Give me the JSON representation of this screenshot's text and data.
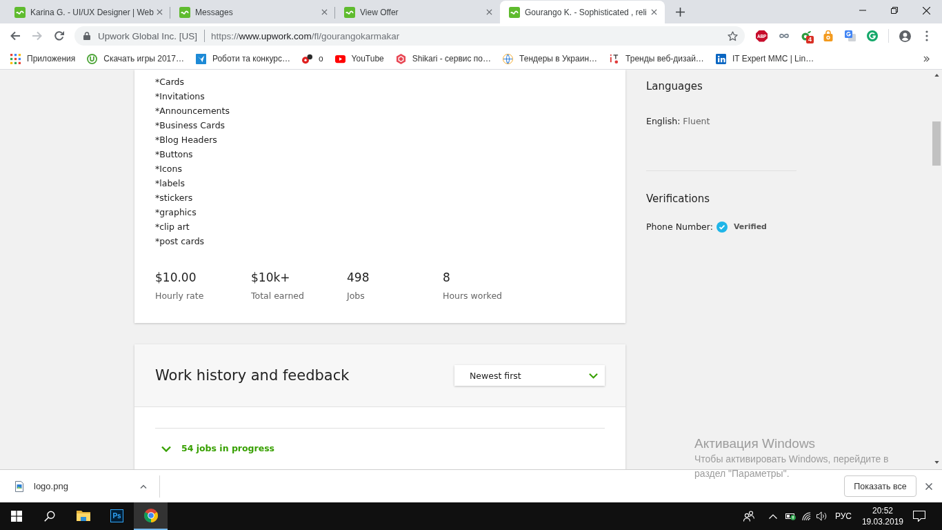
{
  "browser": {
    "tabs": [
      {
        "title": "Karina G. - UI/UX Designer | Web",
        "selected": false
      },
      {
        "title": "Messages",
        "selected": false
      },
      {
        "title": "View Offer",
        "selected": false
      },
      {
        "title": "Gourango K. - Sophisticated , reli",
        "selected": true
      }
    ],
    "navigation": {
      "back_disabled": false,
      "forward_disabled": true
    },
    "address_bar": {
      "site_identity": "Upwork Global Inc. [US]",
      "url_scheme": "https://",
      "url_host": "www.upwork.com",
      "url_path": "/fl/gourangokarmakar",
      "bookmarked": false
    },
    "extensions": {
      "adblock_label": "ABP",
      "badge_count": "4"
    },
    "bookmarks": [
      {
        "kind": "apps",
        "label": "Приложения"
      },
      {
        "kind": "torrent",
        "label": "Скачать игры 2017…"
      },
      {
        "kind": "bird",
        "label": "Роботи та конкурс…"
      },
      {
        "kind": "alert",
        "label": "о"
      },
      {
        "kind": "video",
        "label": "YouTube"
      },
      {
        "kind": "hexagon",
        "label": "Shikari - сервис по…"
      },
      {
        "kind": "globe",
        "label": "Тендеры в Украин…"
      },
      {
        "kind": "marker",
        "label": "Тренды веб-дизай…"
      },
      {
        "kind": "in_logo",
        "label": "IT Expert MMC | Lin…"
      }
    ]
  },
  "profile": {
    "services": [
      "*Cards",
      "*Invitations",
      "*Announcements",
      "*Business Cards",
      "*Blog Headers",
      "*Buttons",
      "*Icons",
      "*labels",
      "*stickers",
      "*graphics",
      "*clip art",
      "*post cards"
    ],
    "stats": [
      {
        "value": "$10.00",
        "label": "Hourly rate"
      },
      {
        "value": "$10k+",
        "label": "Total earned"
      },
      {
        "value": "498",
        "label": "Jobs"
      },
      {
        "value": "8",
        "label": "Hours worked"
      }
    ]
  },
  "work_history": {
    "title": "Work history and feedback",
    "sort": {
      "value": "Newest first"
    },
    "in_progress": {
      "label": "54 jobs in progress"
    }
  },
  "sidebar": {
    "languages": {
      "title": "Languages",
      "items": [
        {
          "language": "English:",
          "proficiency": "Fluent"
        }
      ]
    },
    "verifications": {
      "title": "Verifications",
      "items": [
        {
          "label": "Phone Number:",
          "status": "Verified",
          "verified": true
        }
      ]
    }
  },
  "downloads": {
    "items": [
      {
        "filename": "logo.png"
      }
    ],
    "show_all": "Показать все"
  },
  "taskbar": {
    "apps": [
      {
        "kind": "explorer",
        "active": false
      },
      {
        "kind": "photoshop",
        "label": "Ps",
        "active": false
      },
      {
        "kind": "chrome",
        "active": true
      }
    ]
  },
  "tray": {
    "input_language": "РУС",
    "time": "20:52",
    "date": "19.03.2019"
  },
  "activation_notice": {
    "title": "Активация Windows",
    "text": "Чтобы активировать Windows, перейдите в раздел \"Параметры\"."
  }
}
